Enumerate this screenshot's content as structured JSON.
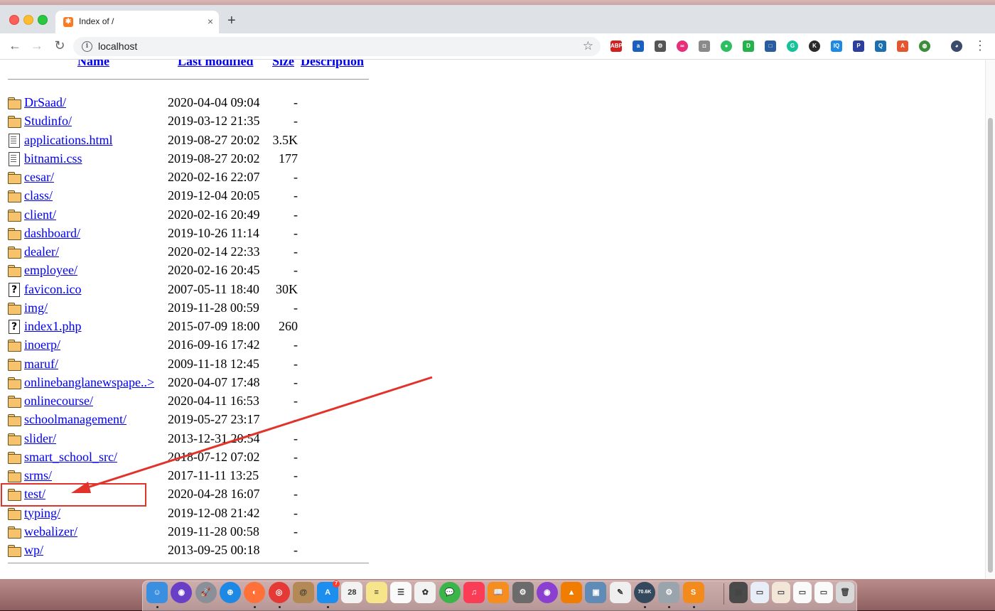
{
  "browser": {
    "tab_title": "Index of /",
    "tab_favicon": "xampp-icon",
    "tab_close": "×",
    "new_tab": "+",
    "url": "localhost",
    "back": "←",
    "forward": "→",
    "reload": "↻",
    "star": "☆",
    "menu": "⋮",
    "extensions": [
      {
        "name": "adblock-plus-icon",
        "label": "ABP",
        "color": "#d21f1f"
      },
      {
        "name": "honey-icon",
        "label": "a",
        "color": "#1b5fbf"
      },
      {
        "name": "gear-extension-icon",
        "label": "⚙",
        "color": "#555555"
      },
      {
        "name": "link-extension-icon",
        "label": "∞",
        "color": "#e62e7b"
      },
      {
        "name": "camera-icon",
        "label": "◘",
        "color": "#8a8a8a"
      },
      {
        "name": "evernote-icon",
        "label": "●",
        "color": "#2dbe60"
      },
      {
        "name": "dot-extension-icon",
        "label": "D",
        "color": "#24b24b"
      },
      {
        "name": "square-extension-icon",
        "label": "□",
        "color": "#2a5d9f"
      },
      {
        "name": "grammarly-icon",
        "label": "G",
        "color": "#15c39a"
      },
      {
        "name": "k-extension-icon",
        "label": "K",
        "color": "#2b2b2b"
      },
      {
        "name": "iq-extension-icon",
        "label": "IQ",
        "color": "#1e88e5"
      },
      {
        "name": "psd-extension-icon",
        "label": "P",
        "color": "#2c3e9e"
      },
      {
        "name": "search-extension-icon",
        "label": "Q",
        "color": "#1a6fb0"
      },
      {
        "name": "triangle-extension-icon",
        "label": "A",
        "color": "#e4572e"
      },
      {
        "name": "globe-extension-icon",
        "label": "◍",
        "color": "#3b8d3b"
      },
      {
        "name": "profile-avatar-icon",
        "label": "◕",
        "color": "#3b4a6b"
      }
    ]
  },
  "listing": {
    "headers": {
      "name": "Name",
      "last_modified": "Last modified",
      "size": "Size",
      "description": "Description"
    },
    "rows": [
      {
        "icon": "folder",
        "name": "DrSaad/",
        "date": "2020-04-04 09:04",
        "size": "-"
      },
      {
        "icon": "folder",
        "name": "Studinfo/",
        "date": "2019-03-12 21:35",
        "size": "-"
      },
      {
        "icon": "doc",
        "name": "applications.html",
        "date": "2019-08-27 20:02",
        "size": "3.5K"
      },
      {
        "icon": "doc",
        "name": "bitnami.css",
        "date": "2019-08-27 20:02",
        "size": "177"
      },
      {
        "icon": "folder",
        "name": "cesar/",
        "date": "2020-02-16 22:07",
        "size": "-"
      },
      {
        "icon": "folder",
        "name": "class/",
        "date": "2019-12-04 20:05",
        "size": "-"
      },
      {
        "icon": "folder",
        "name": "client/",
        "date": "2020-02-16 20:49",
        "size": "-"
      },
      {
        "icon": "folder",
        "name": "dashboard/",
        "date": "2019-10-26 11:14",
        "size": "-"
      },
      {
        "icon": "folder",
        "name": "dealer/",
        "date": "2020-02-14 22:33",
        "size": "-"
      },
      {
        "icon": "folder",
        "name": "employee/",
        "date": "2020-02-16 20:45",
        "size": "-"
      },
      {
        "icon": "unknown",
        "name": "favicon.ico",
        "date": "2007-05-11 18:40",
        "size": "30K"
      },
      {
        "icon": "folder",
        "name": "img/",
        "date": "2019-11-28 00:59",
        "size": "-"
      },
      {
        "icon": "unknown",
        "name": "index1.php",
        "date": "2015-07-09 18:00",
        "size": "260"
      },
      {
        "icon": "folder",
        "name": "inoerp/",
        "date": "2016-09-16 17:42",
        "size": "-"
      },
      {
        "icon": "folder",
        "name": "maruf/",
        "date": "2009-11-18 12:45",
        "size": "-"
      },
      {
        "icon": "folder",
        "name": "onlinebanglanewspape..>",
        "date": "2020-04-07 17:48",
        "size": "-"
      },
      {
        "icon": "folder",
        "name": "onlinecourse/",
        "date": "2020-04-11 16:53",
        "size": "-"
      },
      {
        "icon": "folder",
        "name": "schoolmanagement/",
        "date": "2019-05-27 23:17",
        "size": "-"
      },
      {
        "icon": "folder",
        "name": "slider/",
        "date": "2013-12-31 20:54",
        "size": "-"
      },
      {
        "icon": "folder",
        "name": "smart_school_src/",
        "date": "2018-07-12 07:02",
        "size": "-"
      },
      {
        "icon": "folder",
        "name": "srms/",
        "date": "2017-11-11 13:25",
        "size": "-"
      },
      {
        "icon": "folder",
        "name": "test/",
        "date": "2020-04-28 16:07",
        "size": "-"
      },
      {
        "icon": "folder",
        "name": "typing/",
        "date": "2019-12-08 21:42",
        "size": "-"
      },
      {
        "icon": "folder",
        "name": "webalizer/",
        "date": "2019-11-28 00:58",
        "size": "-"
      },
      {
        "icon": "folder",
        "name": "wp/",
        "date": "2013-09-25 00:18",
        "size": "-"
      }
    ]
  },
  "annotation": {
    "color": "#e2332b",
    "highlighted_item": "test/"
  },
  "dock": {
    "apps": [
      {
        "name": "finder-icon",
        "label": "☺",
        "color": "#3b8fe0"
      },
      {
        "name": "siri-icon",
        "label": "◉",
        "color": "#6a3fc7"
      },
      {
        "name": "launchpad-icon",
        "label": "🚀",
        "color": "#8a8f98"
      },
      {
        "name": "safari-icon",
        "label": "⊕",
        "color": "#1e88e5"
      },
      {
        "name": "firefox-icon",
        "label": "◐",
        "color": "#ff7139"
      },
      {
        "name": "chrome-icon",
        "label": "◎",
        "color": "#e53935"
      },
      {
        "name": "contacts-icon",
        "label": "@",
        "color": "#b38a55"
      },
      {
        "name": "app-store-icon",
        "label": "A",
        "color": "#1c8ef0",
        "badge": "7"
      },
      {
        "name": "calendar-icon",
        "label": "28",
        "color": "#f2f2f2"
      },
      {
        "name": "notes-icon",
        "label": "≡",
        "color": "#f7e58a"
      },
      {
        "name": "reminders-icon",
        "label": "☰",
        "color": "#fafafa"
      },
      {
        "name": "photos-icon",
        "label": "✿",
        "color": "#f2f2f2"
      },
      {
        "name": "messages-icon",
        "label": "💬",
        "color": "#39b54a"
      },
      {
        "name": "music-icon",
        "label": "♫",
        "color": "#fa3c57"
      },
      {
        "name": "books-icon",
        "label": "📖",
        "color": "#f58e1f"
      },
      {
        "name": "system-preferences-icon",
        "label": "⚙",
        "color": "#6b6b6b"
      },
      {
        "name": "podcasts-icon",
        "label": "◉",
        "color": "#8a3fd1"
      },
      {
        "name": "vlc-icon",
        "label": "▲",
        "color": "#f07d00"
      },
      {
        "name": "preview-icon",
        "label": "▣",
        "color": "#5f8bb7"
      },
      {
        "name": "textedit-icon",
        "label": "✎",
        "color": "#efefef"
      },
      {
        "name": "network-monitor-icon",
        "label": "70.6K",
        "color": "#35495e"
      },
      {
        "name": "utility-icon",
        "label": "⚙",
        "color": "#9aa4ad"
      },
      {
        "name": "sublime-text-icon",
        "label": "S",
        "color": "#f28b1b"
      }
    ],
    "recent": [
      {
        "name": "recent-folder-icon-1",
        "label": "▤",
        "color": "#4a4a4a"
      },
      {
        "name": "recent-window-icon-1",
        "label": "▭",
        "color": "#e8eef7"
      },
      {
        "name": "recent-window-icon-2",
        "label": "▭",
        "color": "#f2e6d8"
      },
      {
        "name": "recent-window-icon-3",
        "label": "▭",
        "color": "#fafafa"
      },
      {
        "name": "recent-window-icon-4",
        "label": "▭",
        "color": "#fafafa"
      },
      {
        "name": "trash-icon",
        "label": "🗑",
        "color": "#d8d8d8"
      }
    ]
  }
}
